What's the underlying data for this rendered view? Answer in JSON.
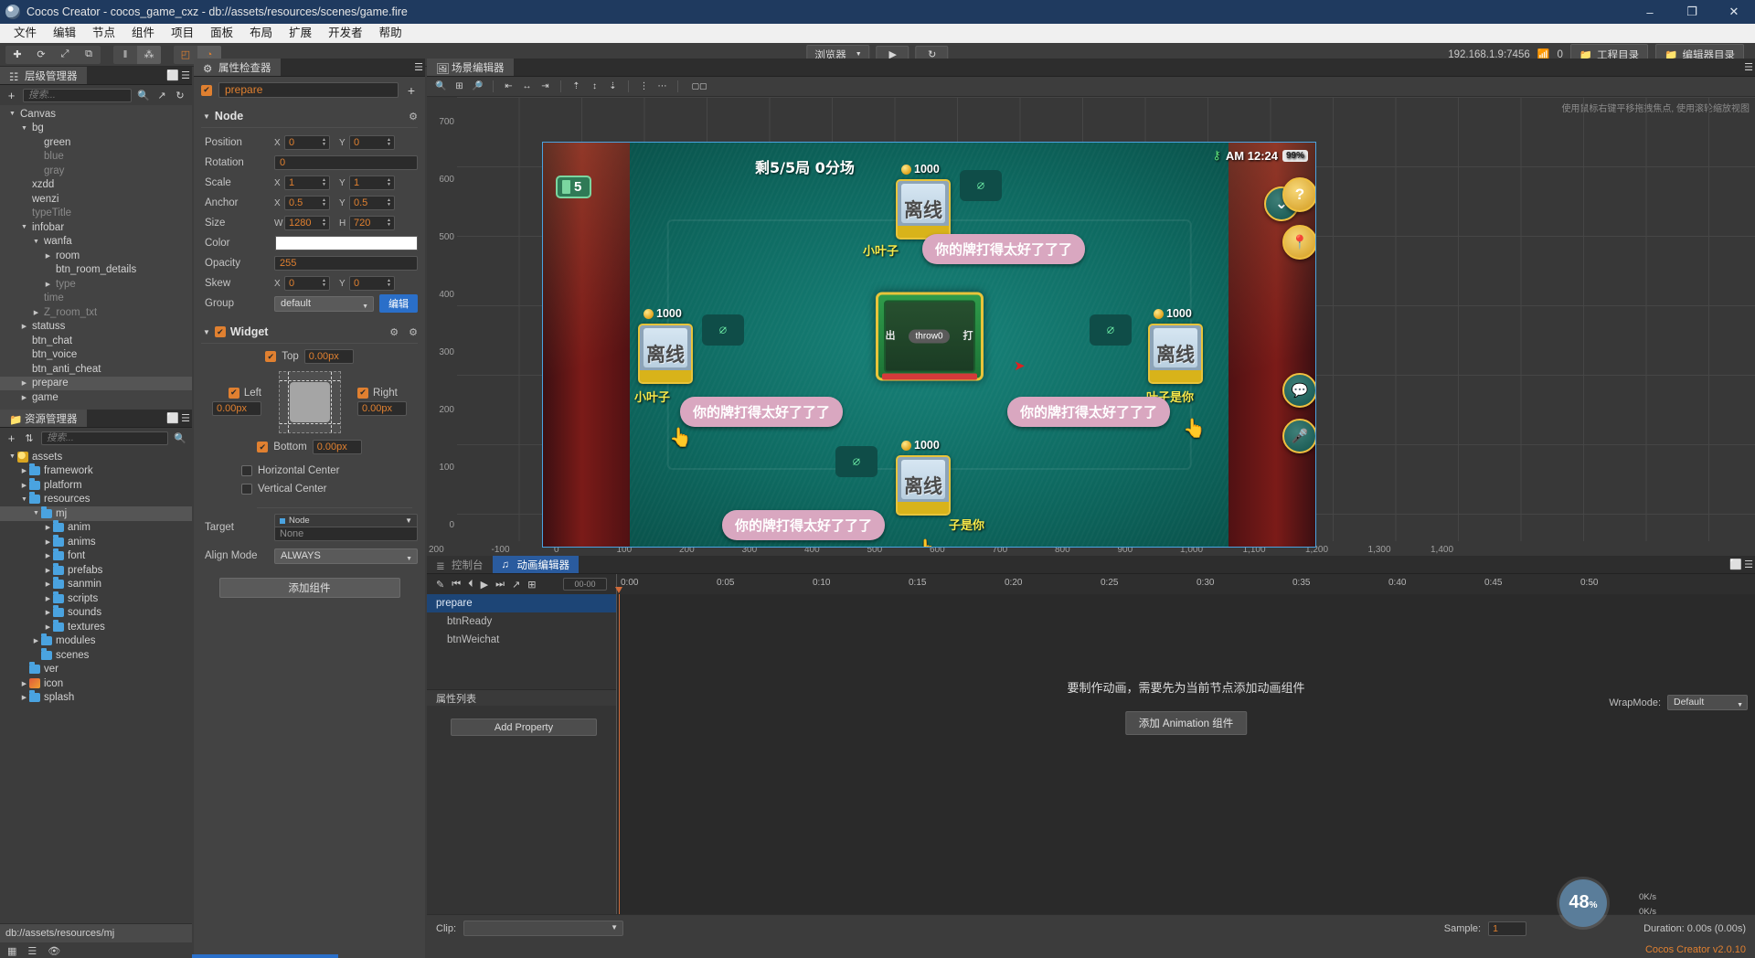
{
  "window": {
    "title": "Cocos Creator - cocos_game_cxz - db://assets/resources/scenes/game.fire",
    "minimize": "–",
    "maximize": "❐",
    "close": "✕"
  },
  "menu": {
    "items": [
      "文件",
      "编辑",
      "节点",
      "组件",
      "项目",
      "面板",
      "布局",
      "扩展",
      "开发者",
      "帮助"
    ]
  },
  "toolbar": {
    "group1": [
      "✚",
      "⟳",
      "⤢",
      "⧉"
    ],
    "group2": [
      "‖",
      "⁂"
    ],
    "group3": [
      "◰",
      "◔"
    ],
    "browser_label": "浏览器",
    "play_label": "▶",
    "refresh_label": "↻",
    "ip": "192.168.1.9:7456",
    "wifi_icon": "wifi-icon",
    "count": "0",
    "project_dir": "工程目录",
    "editor_dir": "编辑器目录"
  },
  "hierarchy": {
    "tab": "层级管理器",
    "tab_icon": "hierarchy-icon",
    "search_placeholder": "搜索...",
    "nodes": [
      {
        "label": "Canvas",
        "depth": 0,
        "arrow": "down",
        "dim": false,
        "selected": false
      },
      {
        "label": "bg",
        "depth": 1,
        "arrow": "down",
        "dim": false,
        "selected": false
      },
      {
        "label": "green",
        "depth": 2,
        "arrow": "none",
        "dim": false,
        "selected": false
      },
      {
        "label": "blue",
        "depth": 2,
        "arrow": "none",
        "dim": true,
        "selected": false
      },
      {
        "label": "gray",
        "depth": 2,
        "arrow": "none",
        "dim": true,
        "selected": false
      },
      {
        "label": "xzdd",
        "depth": 1,
        "arrow": "none",
        "dim": false,
        "selected": false
      },
      {
        "label": "wenzi",
        "depth": 1,
        "arrow": "none",
        "dim": false,
        "selected": false
      },
      {
        "label": "typeTitle",
        "depth": 1,
        "arrow": "none",
        "dim": true,
        "selected": false
      },
      {
        "label": "infobar",
        "depth": 1,
        "arrow": "down",
        "dim": false,
        "selected": false
      },
      {
        "label": "wanfa",
        "depth": 2,
        "arrow": "down",
        "dim": false,
        "selected": false
      },
      {
        "label": "room",
        "depth": 3,
        "arrow": "right",
        "dim": false,
        "selected": false
      },
      {
        "label": "btn_room_details",
        "depth": 3,
        "arrow": "none",
        "dim": false,
        "selected": false
      },
      {
        "label": "type",
        "depth": 3,
        "arrow": "right",
        "dim": true,
        "selected": false
      },
      {
        "label": "time",
        "depth": 2,
        "arrow": "none",
        "dim": true,
        "selected": false
      },
      {
        "label": "Z_room_txt",
        "depth": 2,
        "arrow": "right",
        "dim": true,
        "selected": false
      },
      {
        "label": "statuss",
        "depth": 1,
        "arrow": "right",
        "dim": false,
        "selected": false
      },
      {
        "label": "btn_chat",
        "depth": 1,
        "arrow": "none",
        "dim": false,
        "selected": false
      },
      {
        "label": "btn_voice",
        "depth": 1,
        "arrow": "none",
        "dim": false,
        "selected": false
      },
      {
        "label": "btn_anti_cheat",
        "depth": 1,
        "arrow": "none",
        "dim": false,
        "selected": false
      },
      {
        "label": "prepare",
        "depth": 1,
        "arrow": "right",
        "dim": false,
        "selected": true
      },
      {
        "label": "game",
        "depth": 1,
        "arrow": "right",
        "dim": false,
        "selected": false
      }
    ]
  },
  "assets": {
    "tab": "资源管理器",
    "tab_icon": "folder-icon",
    "search_placeholder": "搜索...",
    "sort_icon": "sort-icon",
    "items": [
      {
        "label": "assets",
        "depth": 0,
        "arrow": "down",
        "type": "root",
        "selected": false
      },
      {
        "label": "framework",
        "depth": 1,
        "arrow": "right",
        "type": "folder",
        "selected": false
      },
      {
        "label": "platform",
        "depth": 1,
        "arrow": "right",
        "type": "folder",
        "selected": false
      },
      {
        "label": "resources",
        "depth": 1,
        "arrow": "down",
        "type": "folder",
        "selected": false
      },
      {
        "label": "mj",
        "depth": 2,
        "arrow": "down",
        "type": "folder",
        "selected": true
      },
      {
        "label": "anim",
        "depth": 3,
        "arrow": "right",
        "type": "folder",
        "selected": false
      },
      {
        "label": "anims",
        "depth": 3,
        "arrow": "right",
        "type": "folder",
        "selected": false
      },
      {
        "label": "font",
        "depth": 3,
        "arrow": "right",
        "type": "folder",
        "selected": false
      },
      {
        "label": "prefabs",
        "depth": 3,
        "arrow": "right",
        "type": "folder",
        "selected": false
      },
      {
        "label": "sanmin",
        "depth": 3,
        "arrow": "right",
        "type": "folder",
        "selected": false
      },
      {
        "label": "scripts",
        "depth": 3,
        "arrow": "right",
        "type": "folder",
        "selected": false
      },
      {
        "label": "sounds",
        "depth": 3,
        "arrow": "right",
        "type": "folder",
        "selected": false
      },
      {
        "label": "textures",
        "depth": 3,
        "arrow": "right",
        "type": "folder",
        "selected": false
      },
      {
        "label": "modules",
        "depth": 2,
        "arrow": "right",
        "type": "folder",
        "selected": false
      },
      {
        "label": "scenes",
        "depth": 2,
        "arrow": "none",
        "type": "folder",
        "selected": false
      },
      {
        "label": "ver",
        "depth": 1,
        "arrow": "none",
        "type": "folder",
        "selected": false
      },
      {
        "label": "icon",
        "depth": 1,
        "arrow": "right",
        "type": "image",
        "selected": false
      },
      {
        "label": "splash",
        "depth": 1,
        "arrow": "right",
        "type": "folder",
        "selected": false
      }
    ],
    "status_path": "db://assets/resources/mj"
  },
  "inspector": {
    "tab": "属性检查器",
    "tab_icon": "gear-icon",
    "node_enabled": true,
    "node_name": "prepare",
    "node_section": "Node",
    "properties": [
      {
        "label": "Position",
        "fields": [
          {
            "axis": "X",
            "value": "0"
          },
          {
            "axis": "Y",
            "value": "0"
          }
        ]
      },
      {
        "label": "Rotation",
        "fields": [
          {
            "axis": "",
            "value": "0"
          }
        ]
      },
      {
        "label": "Scale",
        "fields": [
          {
            "axis": "X",
            "value": "1"
          },
          {
            "axis": "Y",
            "value": "1"
          }
        ]
      },
      {
        "label": "Anchor",
        "fields": [
          {
            "axis": "X",
            "value": "0.5"
          },
          {
            "axis": "Y",
            "value": "0.5"
          }
        ]
      },
      {
        "label": "Size",
        "fields": [
          {
            "axis": "W",
            "value": "1280"
          },
          {
            "axis": "H",
            "value": "720"
          }
        ]
      },
      {
        "label": "Color",
        "fields": [],
        "color": "#ffffff"
      },
      {
        "label": "Opacity",
        "fields": [
          {
            "axis": "",
            "value": "255"
          }
        ]
      },
      {
        "label": "Skew",
        "fields": [
          {
            "axis": "X",
            "value": "0"
          },
          {
            "axis": "Y",
            "value": "0"
          }
        ]
      }
    ],
    "group_label": "Group",
    "group_value": "default",
    "group_edit": "编辑",
    "widget": {
      "title": "Widget",
      "enabled": true,
      "top_label": "Top",
      "top_value": "0.00px",
      "top_on": true,
      "left_label": "Left",
      "left_value": "0.00px",
      "left_on": true,
      "right_label": "Right",
      "right_value": "0.00px",
      "right_on": true,
      "bottom_label": "Bottom",
      "bottom_value": "0.00px",
      "bottom_on": true,
      "horizontal_center": "Horizontal Center",
      "horizontal_center_on": false,
      "vertical_center": "Vertical Center",
      "vertical_center_on": false,
      "target_label": "Target",
      "target_node": "Node",
      "target_value": "None",
      "align_label": "Align Mode",
      "align_value": "ALWAYS"
    },
    "add_component": "添加组件"
  },
  "scene": {
    "tab": "场景编辑器",
    "tab_icon": "scene-icon",
    "hint": "使用鼠标右键平移拖拽焦点, 使用滚轮缩放视图",
    "v_ticks": [
      "700",
      "600",
      "500",
      "400",
      "300",
      "200",
      "100",
      "0"
    ],
    "h_ticks": [
      "200",
      "-100",
      "0",
      "100",
      "200",
      "300",
      "400",
      "500",
      "600",
      "700",
      "800",
      "900",
      "1,000",
      "1,100",
      "1,200",
      "1,300",
      "1,400"
    ],
    "game": {
      "round_text": "剩5/5局   0分场",
      "battery_count": "5",
      "status_time": "AM 12:24",
      "status_battery": "99%",
      "status_wifi": "wifi-icon",
      "center_throw": "throw0",
      "center_left": "出",
      "center_right": "打",
      "players": [
        {
          "money": "1000",
          "offline": "离线",
          "nick": "小叶子",
          "bubble": "你的牌打得太好了了了"
        },
        {
          "money": "1000",
          "offline": "离线",
          "nick": "小叶子",
          "bubble": "你的牌打得太好了了了"
        },
        {
          "money": "1000",
          "offline": "离线",
          "nick": "叶子是你",
          "bubble": "你的牌打得太好了了了"
        },
        {
          "money": "1000",
          "offline": "离线",
          "nick": "子是你",
          "bubble": "你的牌打得太好了了了"
        }
      ],
      "side_buttons": [
        "⌄",
        "?",
        "⌖",
        "●",
        "●"
      ]
    }
  },
  "bottom": {
    "console_tab": "控制台",
    "console_icon": "console-icon",
    "anim_tab": "动画编辑器",
    "anim_icon": "animation-icon",
    "timecode": "00-00",
    "controls": [
      "✎",
      "⏮",
      "⏴",
      "▶",
      "⏭",
      "↗",
      "⊞"
    ],
    "ruler": [
      "0:00",
      "0:05",
      "0:10",
      "0:15",
      "0:20",
      "0:25",
      "0:30",
      "0:35",
      "0:40",
      "0:45",
      "0:50"
    ],
    "tracks": [
      {
        "label": "prepare",
        "selected": true
      },
      {
        "label": "btnReady",
        "selected": false
      },
      {
        "label": "btnWeichat",
        "selected": false
      }
    ],
    "prop_list_label": "属性列表",
    "add_property": "Add Property",
    "message": "要制作动画，需要先为当前节点添加动画组件",
    "add_anim_component": "添加 Animation 组件",
    "wrapmode_label": "WrapMode:",
    "wrapmode_value": "Default",
    "clip_label": "Clip:",
    "sample_label": "Sample:",
    "sample_value": "1",
    "duration": "Duration: 0.00s (0.00s)",
    "fps": "48",
    "fps_unit": "%",
    "net_up": "0K/s",
    "net_down": "0K/s",
    "brand": "Cocos Creator v2.0.10"
  }
}
